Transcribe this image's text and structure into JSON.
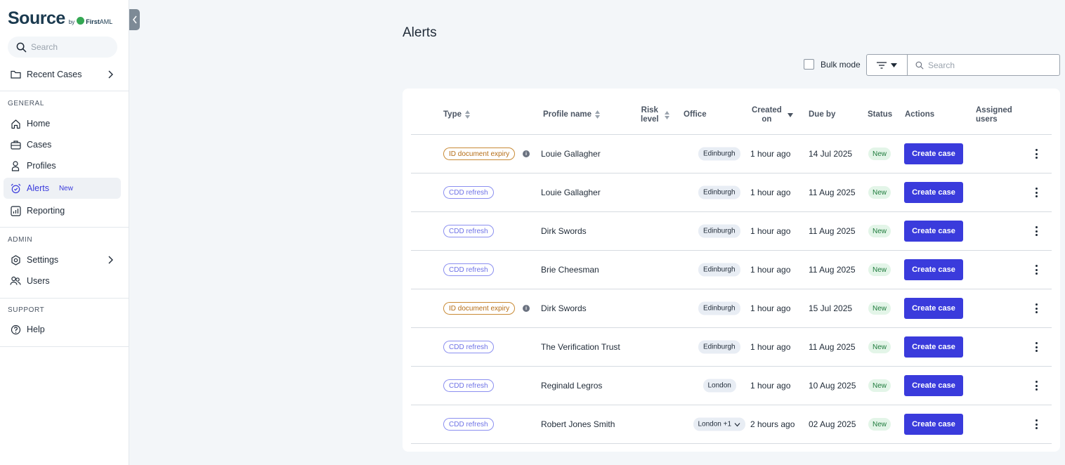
{
  "brand": {
    "name": "Source",
    "by": "by",
    "partner_bold": "First",
    "partner_light": "AML"
  },
  "sidebar": {
    "search_placeholder": "Search",
    "recent_cases": "Recent Cases",
    "general_title": "GENERAL",
    "general_items": [
      {
        "label": "Home",
        "icon": "home-icon"
      },
      {
        "label": "Cases",
        "icon": "briefcase-icon"
      },
      {
        "label": "Profiles",
        "icon": "person-icon"
      },
      {
        "label": "Alerts",
        "icon": "alarm-clock-icon",
        "badge": "New",
        "active": true
      },
      {
        "label": "Reporting",
        "icon": "chart-icon"
      }
    ],
    "admin_title": "ADMIN",
    "admin_items": [
      {
        "label": "Settings",
        "icon": "gear-icon"
      },
      {
        "label": "Users",
        "icon": "users-icon"
      }
    ],
    "support_title": "SUPPORT",
    "support_items": [
      {
        "label": "Help",
        "icon": "help-icon"
      }
    ]
  },
  "main": {
    "title": "Alerts",
    "bulk_mode_label": "Bulk mode",
    "search_placeholder": "Search",
    "columns": {
      "type": "Type",
      "profile_name": "Profile name",
      "risk_level_1": "Risk",
      "risk_level_2": "level",
      "office": "Office",
      "created_on_1": "Created",
      "created_on_2": "on",
      "due_by": "Due by",
      "status": "Status",
      "actions": "Actions",
      "assigned_1": "Assigned",
      "assigned_2": "users"
    },
    "rows": [
      {
        "type": "ID document expiry",
        "kind": "expiry",
        "info": true,
        "name": "Louie Gallagher",
        "office": "Edinburgh",
        "created": "1 hour ago",
        "due": "14 Jul 2025",
        "status": "New",
        "action": "Create case"
      },
      {
        "type": "CDD refresh",
        "kind": "cdd",
        "info": false,
        "name": "Louie Gallagher",
        "office": "Edinburgh",
        "created": "1 hour ago",
        "due": "11 Aug 2025",
        "status": "New",
        "action": "Create case"
      },
      {
        "type": "CDD refresh",
        "kind": "cdd",
        "info": false,
        "name": "Dirk Swords",
        "office": "Edinburgh",
        "created": "1 hour ago",
        "due": "11 Aug 2025",
        "status": "New",
        "action": "Create case"
      },
      {
        "type": "CDD refresh",
        "kind": "cdd",
        "info": false,
        "name": "Brie Cheesman",
        "office": "Edinburgh",
        "created": "1 hour ago",
        "due": "11 Aug 2025",
        "status": "New",
        "action": "Create case"
      },
      {
        "type": "ID document expiry",
        "kind": "expiry",
        "info": true,
        "name": "Dirk Swords",
        "office": "Edinburgh",
        "created": "1 hour ago",
        "due": "15 Jul 2025",
        "status": "New",
        "action": "Create case"
      },
      {
        "type": "CDD refresh",
        "kind": "cdd",
        "info": false,
        "name": "The Verification Trust",
        "office": "Edinburgh",
        "created": "1 hour ago",
        "due": "11 Aug 2025",
        "status": "New",
        "action": "Create case"
      },
      {
        "type": "CDD refresh",
        "kind": "cdd",
        "info": false,
        "name": "Reginald Legros",
        "office": "London",
        "created": "1 hour ago",
        "due": "10 Aug 2025",
        "status": "New",
        "action": "Create case"
      },
      {
        "type": "CDD refresh",
        "kind": "cdd",
        "info": false,
        "name": "Robert Jones Smith",
        "office": "London +1",
        "office_dropdown": true,
        "created": "2 hours ago",
        "due": "02 Aug 2025",
        "status": "New",
        "action": "Create case"
      }
    ]
  }
}
